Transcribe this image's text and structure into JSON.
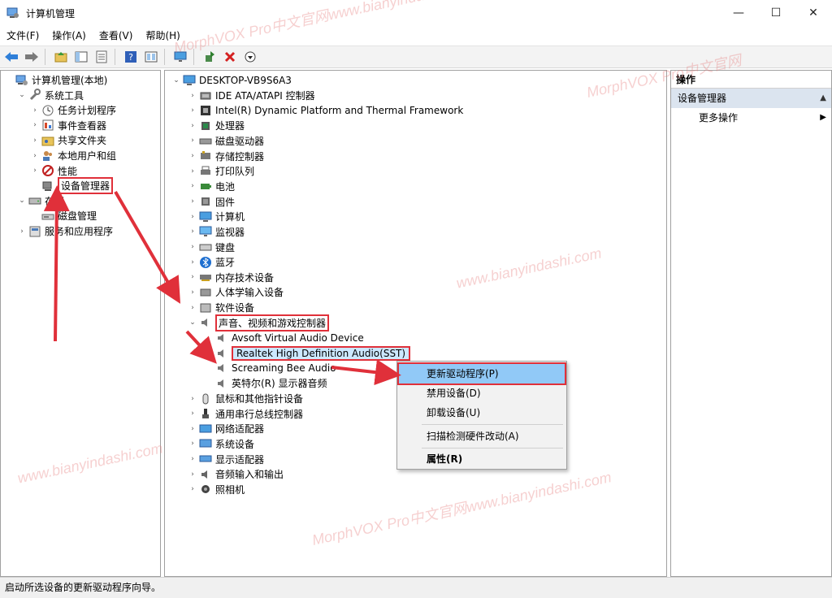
{
  "window": {
    "title": "计算机管理",
    "controls": [
      "—",
      "☐",
      "✕"
    ]
  },
  "menu": [
    "文件(F)",
    "操作(A)",
    "查看(V)",
    "帮助(H)"
  ],
  "left_tree": [
    {
      "label": "计算机管理(本地)",
      "indent": 0,
      "chev": "",
      "icon": "computer-management-icon"
    },
    {
      "label": "系统工具",
      "indent": 1,
      "chev": "⌄",
      "icon": "tools-icon"
    },
    {
      "label": "任务计划程序",
      "indent": 2,
      "chev": "›",
      "icon": "clock-icon"
    },
    {
      "label": "事件查看器",
      "indent": 2,
      "chev": "›",
      "icon": "event-viewer-icon"
    },
    {
      "label": "共享文件夹",
      "indent": 2,
      "chev": "›",
      "icon": "shared-folder-icon"
    },
    {
      "label": "本地用户和组",
      "indent": 2,
      "chev": "›",
      "icon": "users-icon"
    },
    {
      "label": "性能",
      "indent": 2,
      "chev": "›",
      "icon": "performance-icon"
    },
    {
      "label": "设备管理器",
      "indent": 2,
      "chev": "",
      "icon": "device-manager-icon",
      "selected": true
    },
    {
      "label": "存储",
      "indent": 1,
      "chev": "⌄",
      "icon": "storage-icon"
    },
    {
      "label": "磁盘管理",
      "indent": 2,
      "chev": "",
      "icon": "disk-icon"
    },
    {
      "label": "服务和应用程序",
      "indent": 1,
      "chev": "›",
      "icon": "services-icon"
    }
  ],
  "device_tree": {
    "root": "DESKTOP-VB9S6A3",
    "items": [
      {
        "label": "IDE ATA/ATAPI 控制器",
        "chev": "›",
        "indent": 1,
        "icon": "ide-controller-icon"
      },
      {
        "label": "Intel(R) Dynamic Platform and Thermal Framework",
        "chev": "›",
        "indent": 1,
        "icon": "intel-framework-icon"
      },
      {
        "label": "处理器",
        "chev": "›",
        "indent": 1,
        "icon": "processor-icon"
      },
      {
        "label": "磁盘驱动器",
        "chev": "›",
        "indent": 1,
        "icon": "disk-drive-icon"
      },
      {
        "label": "存储控制器",
        "chev": "›",
        "indent": 1,
        "icon": "storage-controller-icon"
      },
      {
        "label": "打印队列",
        "chev": "›",
        "indent": 1,
        "icon": "printer-icon"
      },
      {
        "label": "电池",
        "chev": "›",
        "indent": 1,
        "icon": "battery-icon"
      },
      {
        "label": "固件",
        "chev": "›",
        "indent": 1,
        "icon": "firmware-icon"
      },
      {
        "label": "计算机",
        "chev": "›",
        "indent": 1,
        "icon": "computer-icon"
      },
      {
        "label": "监视器",
        "chev": "›",
        "indent": 1,
        "icon": "monitor-icon"
      },
      {
        "label": "键盘",
        "chev": "›",
        "indent": 1,
        "icon": "keyboard-icon"
      },
      {
        "label": "蓝牙",
        "chev": "›",
        "indent": 1,
        "icon": "bluetooth-icon"
      },
      {
        "label": "内存技术设备",
        "chev": "›",
        "indent": 1,
        "icon": "memory-device-icon"
      },
      {
        "label": "人体学输入设备",
        "chev": "›",
        "indent": 1,
        "icon": "hid-icon"
      },
      {
        "label": "软件设备",
        "chev": "›",
        "indent": 1,
        "icon": "software-device-icon"
      },
      {
        "label": "声音、视频和游戏控制器",
        "chev": "⌄",
        "indent": 1,
        "icon": "speaker-icon",
        "boxed": true
      },
      {
        "label": "Avsoft Virtual Audio Device",
        "chev": "",
        "indent": 2,
        "icon": "speaker-icon"
      },
      {
        "label": "Realtek High Definition Audio(SST)",
        "chev": "",
        "indent": 2,
        "icon": "speaker-icon",
        "boxed": true,
        "highlight": true
      },
      {
        "label": "Screaming Bee Audio",
        "chev": "",
        "indent": 2,
        "icon": "speaker-icon"
      },
      {
        "label": "英特尔(R) 显示器音频",
        "chev": "",
        "indent": 2,
        "icon": "speaker-icon"
      },
      {
        "label": "鼠标和其他指针设备",
        "chev": "›",
        "indent": 1,
        "icon": "mouse-icon"
      },
      {
        "label": "通用串行总线控制器",
        "chev": "›",
        "indent": 1,
        "icon": "usb-icon"
      },
      {
        "label": "网络适配器",
        "chev": "›",
        "indent": 1,
        "icon": "network-adapter-icon"
      },
      {
        "label": "系统设备",
        "chev": "›",
        "indent": 1,
        "icon": "system-device-icon"
      },
      {
        "label": "显示适配器",
        "chev": "›",
        "indent": 1,
        "icon": "display-adapter-icon"
      },
      {
        "label": "音频输入和输出",
        "chev": "›",
        "indent": 1,
        "icon": "audio-io-icon"
      },
      {
        "label": "照相机",
        "chev": "›",
        "indent": 1,
        "icon": "camera-icon"
      }
    ]
  },
  "actions_pane": {
    "header": "操作",
    "section": "设备管理器",
    "more": "更多操作"
  },
  "context_menu": [
    {
      "label": "更新驱动程序(P)",
      "highlight": true
    },
    {
      "label": "禁用设备(D)"
    },
    {
      "label": "卸载设备(U)"
    },
    {
      "label": "扫描检测硬件改动(A)"
    },
    {
      "label": "属性(R)",
      "bold": true
    }
  ],
  "status_text": "启动所选设备的更新驱动程序向导。",
  "watermarks": [
    "MorphVOX Pro中文官网www.bianyindashi.com",
    "www.bianyindashi.com",
    "MorphVOX Pro中文官网"
  ],
  "colors": {
    "annotation_red": "#e0303a",
    "selection_blue": "#91c9f7",
    "section_bg": "#dbe4ef"
  }
}
